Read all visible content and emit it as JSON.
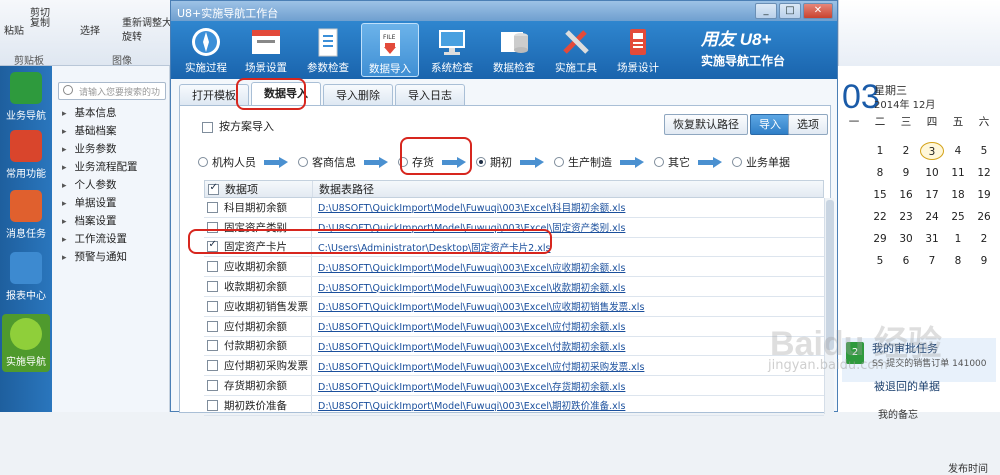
{
  "ribbon": {
    "paste": "粘贴",
    "cut": "剪切",
    "copy": "复制",
    "select": "选择",
    "rotate": "旋转",
    "resize": "重新调整大",
    "clipboard": "剪贴板",
    "image": "图像"
  },
  "app_sidebar": {
    "items": [
      "业务导航",
      "常用功能",
      "消息任务",
      "报表中心",
      "实施导航"
    ]
  },
  "nav_panel": {
    "search_placeholder": "请输入您要搜索的功",
    "items": [
      "基本信息",
      "基础档案",
      "业务参数",
      "业务流程配置",
      "个人参数",
      "单据设置",
      "档案设置",
      "工作流设置",
      "预警与通知"
    ]
  },
  "calendar": {
    "big_day": "03",
    "weekday": "星期三",
    "year_month": "2014年 12月",
    "headers": [
      "一",
      "二",
      "三",
      "四",
      "五",
      "六"
    ],
    "days": [
      "",
      "1",
      "2",
      "3",
      "4",
      "5",
      "",
      "8",
      "9",
      "10",
      "11",
      "12",
      "",
      "15",
      "16",
      "17",
      "18",
      "19",
      "",
      "22",
      "23",
      "24",
      "25",
      "26",
      "",
      "29",
      "30",
      "31",
      "1",
      "2",
      "",
      "5",
      "6",
      "7",
      "8",
      "9"
    ],
    "task_title": "我的审批任务",
    "task_sub": "SS 提交的销售订单 141000",
    "returned": "被退回的单据",
    "middle": "我的备忘",
    "publish": "发布时间"
  },
  "dialog": {
    "title": "U8+实施导航工作台",
    "toolbar": [
      "实施过程",
      "场景设置",
      "参数检查",
      "数据导入",
      "系统检查",
      "数据check",
      "实施工具",
      "场景设计"
    ],
    "brand_line1": "用友 U8+",
    "brand_line2": "实施导航工作台",
    "tabs": [
      "打开模板",
      "数据导入",
      "导入删除",
      "导入日志"
    ],
    "by_scheme": "按方案导入",
    "buttons": {
      "restore": "恢复默认路径",
      "import": "导入",
      "options": "选项"
    },
    "steps": [
      "机构人员",
      "客商信息",
      "存货",
      "期初",
      "生产制造",
      "其它",
      "业务单据"
    ],
    "columns": [
      "数据项",
      "数据表路径"
    ],
    "rows": [
      {
        "name": "科目期初余额",
        "path": "D:\\U8SOFT\\QuickImport\\Model\\Fuwuqi\\003\\Excel\\科目期初余额.xls"
      },
      {
        "name": "固定资产类别",
        "path": "D:\\U8SOFT\\QuickImport\\Model\\Fuwuqi\\003\\Excel\\固定资产类别.xls"
      },
      {
        "name": "固定资产卡片",
        "path": "C:\\Users\\Administrator\\Desktop\\固定资产卡片2.xls"
      },
      {
        "name": "应收期初余额",
        "path": "D:\\U8SOFT\\QuickImport\\Model\\Fuwuqi\\003\\Excel\\应收期初余额.xls"
      },
      {
        "name": "收款期初余额",
        "path": "D:\\U8SOFT\\QuickImport\\Model\\Fuwuqi\\003\\Excel\\收款期初余额.xls"
      },
      {
        "name": "应收期初销售发票",
        "path": "D:\\U8SOFT\\QuickImport\\Model\\Fuwuqi\\003\\Excel\\应收期初销售发票.xls"
      },
      {
        "name": "应付期初余额",
        "path": "D:\\U8SOFT\\QuickImport\\Model\\Fuwuqi\\003\\Excel\\应付期初余额.xls"
      },
      {
        "name": "付款期初余额",
        "path": "D:\\U8SOFT\\QuickImport\\Model\\Fuwuqi\\003\\Excel\\付款期初余额.xls"
      },
      {
        "name": "应付期初采购发票",
        "path": "D:\\U8SOFT\\QuickImport\\Model\\Fuwuqi\\003\\Excel\\应付期初采购发票.xls"
      },
      {
        "name": "存货期初余额",
        "path": "D:\\U8SOFT\\QuickImport\\Model\\Fuwuqi\\003\\Excel\\存货期初余额.xls"
      },
      {
        "name": "期初跌价准备",
        "path": "D:\\U8SOFT\\QuickImport\\Model\\Fuwuqi\\003\\Excel\\期初跌价准备.xls"
      }
    ]
  },
  "watermark": {
    "text": "Baidu 经验",
    "url": "jingyan.baidu.com"
  },
  "colors": {
    "toolbar": "#1a64ad",
    "highlight": "#d7261e",
    "link": "#1a4f9c"
  }
}
